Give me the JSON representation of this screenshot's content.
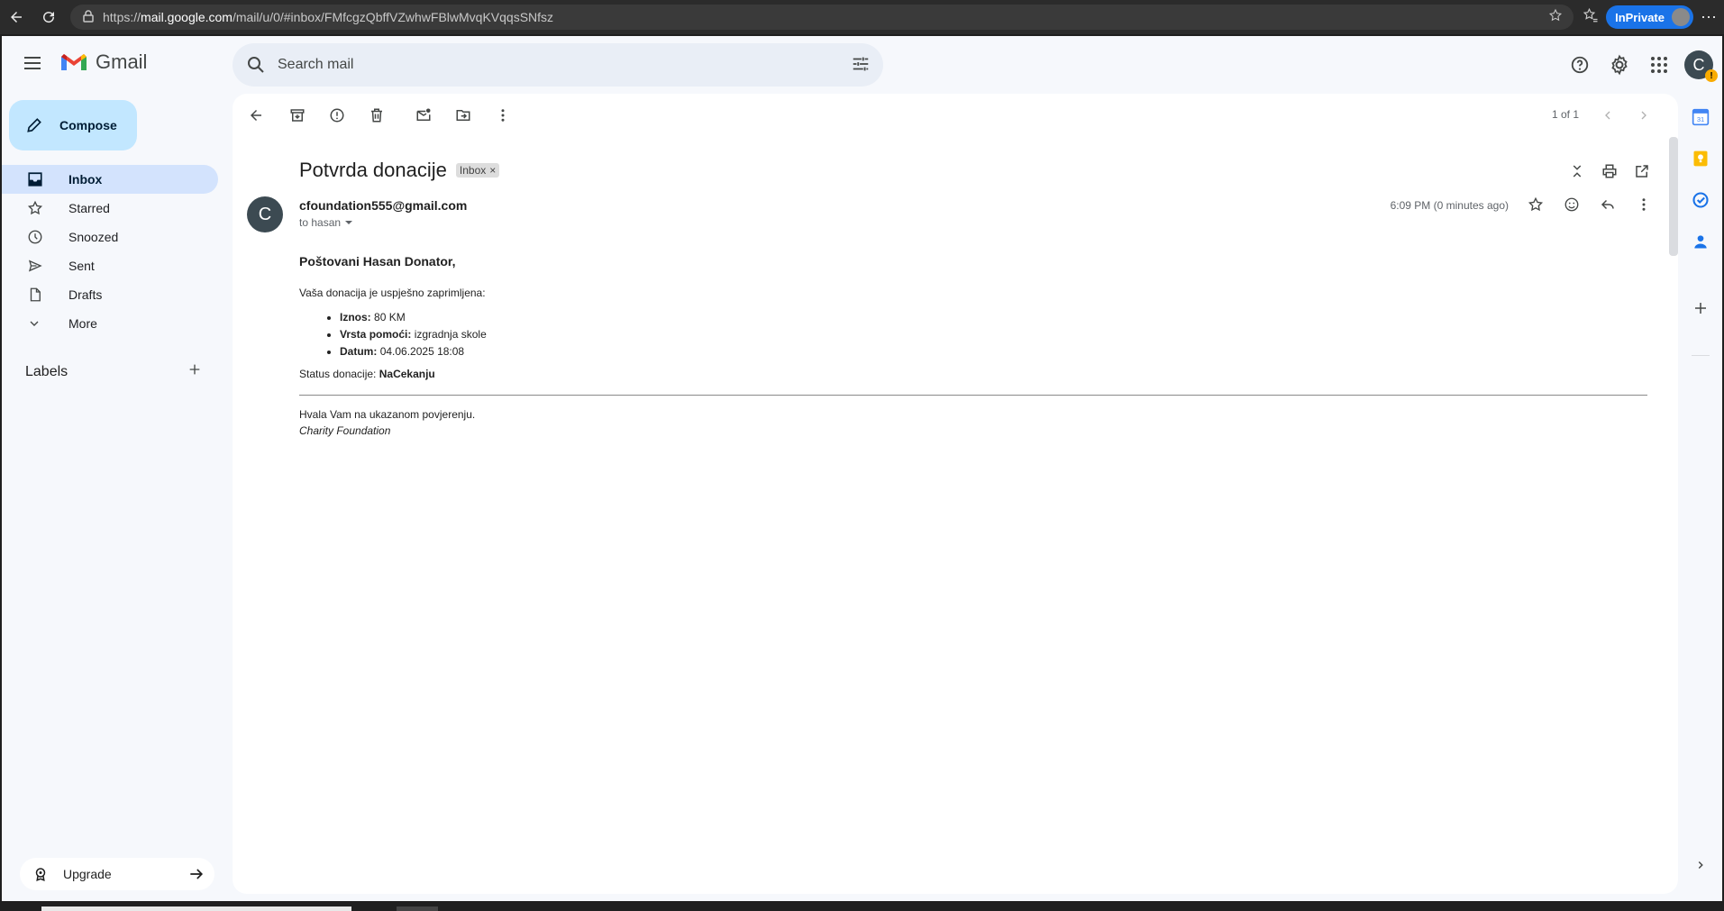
{
  "browser": {
    "url_prefix": "https://",
    "url_host": "mail.google.com",
    "url_path": "/mail/u/0/#inbox/FMfcgzQbffVZwhwFBlwMvqKVqqsSNfsz",
    "inprivate_label": "InPrivate"
  },
  "app": {
    "name": "Gmail",
    "search_placeholder": "Search mail",
    "account_initial": "C",
    "warning_mark": "!"
  },
  "sidebar": {
    "compose_label": "Compose",
    "items": [
      {
        "label": "Inbox",
        "icon": "inbox-icon",
        "active": true
      },
      {
        "label": "Starred",
        "icon": "star-icon"
      },
      {
        "label": "Snoozed",
        "icon": "clock-icon"
      },
      {
        "label": "Sent",
        "icon": "send-icon"
      },
      {
        "label": "Drafts",
        "icon": "draft-icon"
      },
      {
        "label": "More",
        "icon": "chevron-down-icon"
      }
    ],
    "labels_heading": "Labels",
    "upgrade_label": "Upgrade"
  },
  "toolbar": {
    "pager_text": "1 of 1"
  },
  "email": {
    "subject": "Potvrda donacije",
    "label_chip": "Inbox",
    "sender_initial": "C",
    "sender": "cfoundation555@gmail.com",
    "to_line": "to hasan",
    "time": "6:09 PM (0 minutes ago)",
    "greeting": "Poštovani Hasan Donator,",
    "intro": "Vaša donacija je uspješno zaprimljena:",
    "details": [
      {
        "key": "Iznos:",
        "value": "80 KM"
      },
      {
        "key": "Vrsta pomoći:",
        "value": "izgradnja skole"
      },
      {
        "key": "Datum:",
        "value": "04.06.2025 18:08"
      }
    ],
    "status_label": "Status donacije:",
    "status_value": "NaCekanju",
    "thanks": "Hvala Vam na ukazanom povjerenju.",
    "signature": "Charity Foundation"
  },
  "colors": {
    "accent": "#1a73e8",
    "compose_bg": "#c2e7ff",
    "active_nav_bg": "#d3e3fd",
    "avatar_bg": "#3c4a52"
  }
}
